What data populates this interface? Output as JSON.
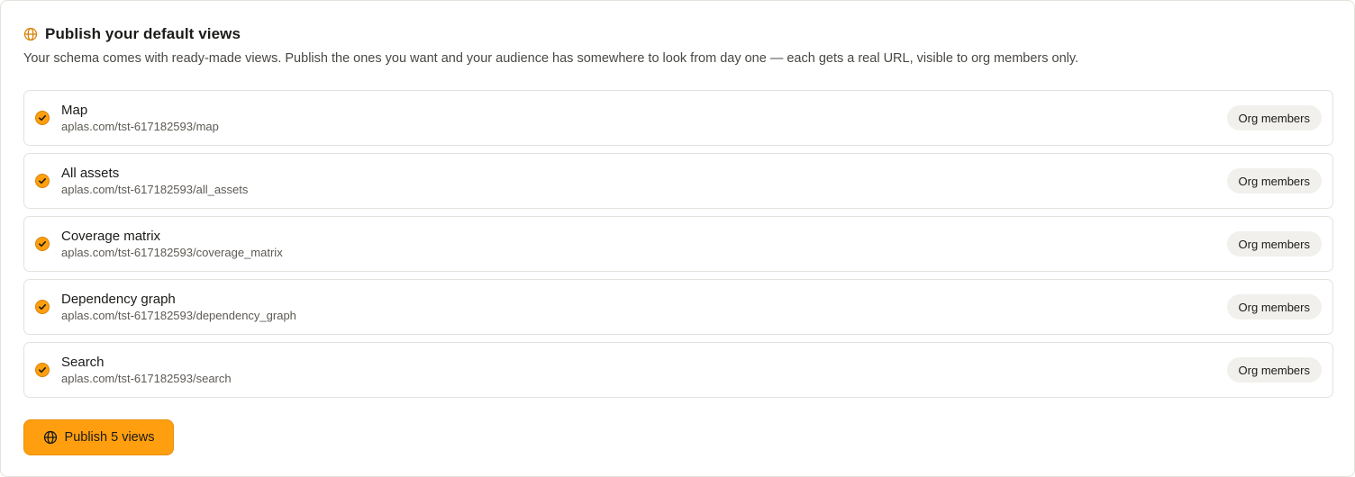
{
  "header": {
    "title": "Publish your default views",
    "subtitle": "Your schema comes with ready-made views. Publish the ones you want and your audience has somewhere to look from day one — each gets a real URL, visible to org members only.",
    "icon": "globe-icon"
  },
  "views": [
    {
      "title": "Map",
      "url": "aplas.com/tst-617182593/map",
      "visibility": "Org members",
      "checked": true
    },
    {
      "title": "All assets",
      "url": "aplas.com/tst-617182593/all_assets",
      "visibility": "Org members",
      "checked": true
    },
    {
      "title": "Coverage matrix",
      "url": "aplas.com/tst-617182593/coverage_matrix",
      "visibility": "Org members",
      "checked": true
    },
    {
      "title": "Dependency graph",
      "url": "aplas.com/tst-617182593/dependency_graph",
      "visibility": "Org members",
      "checked": true
    },
    {
      "title": "Search",
      "url": "aplas.com/tst-617182593/search",
      "visibility": "Org members",
      "checked": true
    }
  ],
  "publish_button": {
    "label": "Publish 5 views",
    "icon": "globe-icon"
  },
  "colors": {
    "accent": "#ff9f0f",
    "badge_bg": "#f1f0ed",
    "border": "#e4e2dd"
  }
}
